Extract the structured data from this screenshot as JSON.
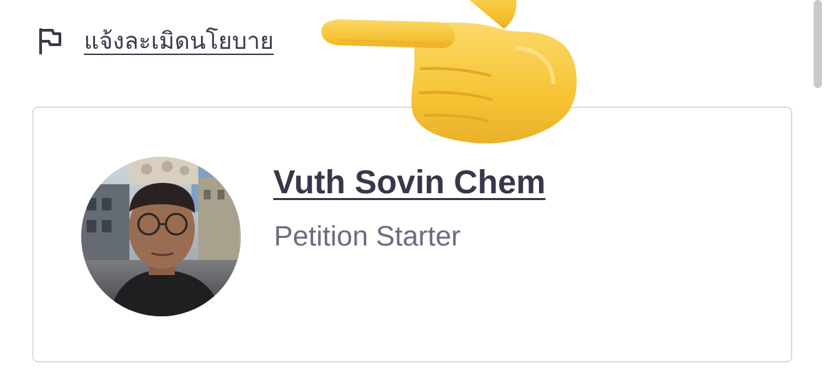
{
  "report": {
    "icon": "flag-icon",
    "label": "แจ้งละเมิดนโยบาย"
  },
  "starter": {
    "name": "Vuth Sovin Chem",
    "role": "Petition Starter",
    "avatar_icon": "avatar-photo"
  },
  "overlay": {
    "icon": "pointing-hand-emoji",
    "color": "#f7c634"
  },
  "colors": {
    "text_dark": "#3a364a",
    "text_muted": "#6e6a7e",
    "card_border": "#dcdbe1"
  }
}
